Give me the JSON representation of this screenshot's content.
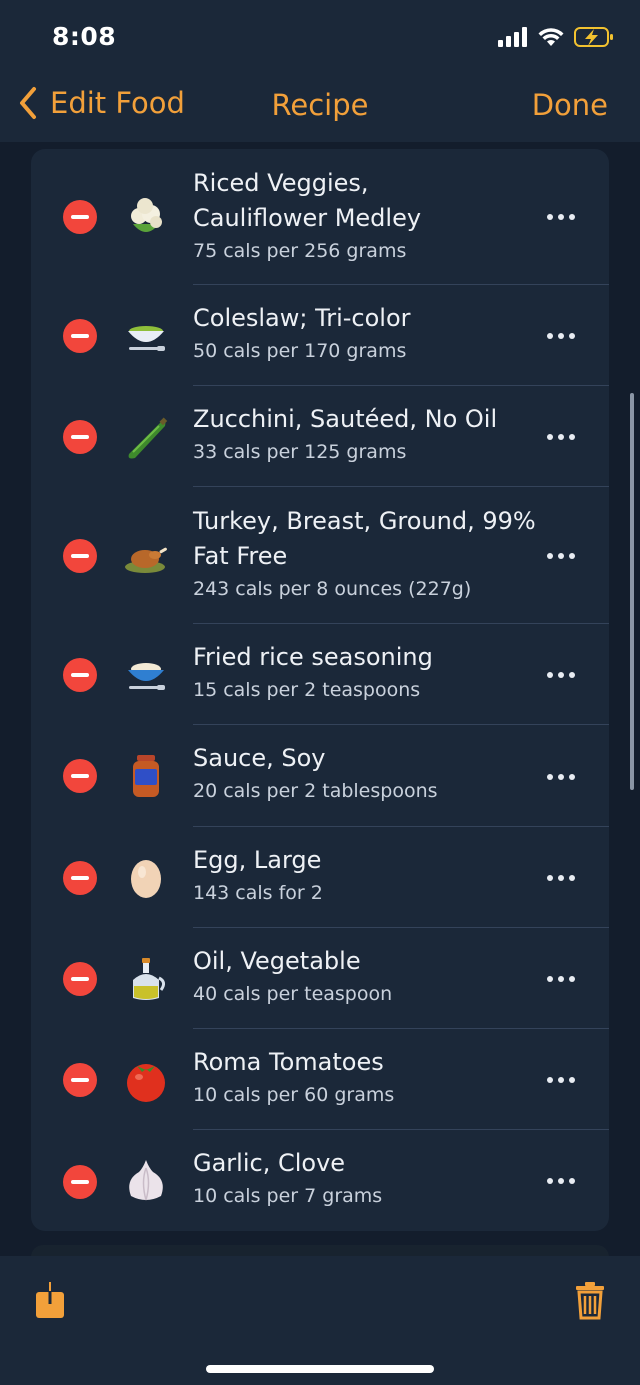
{
  "status_bar": {
    "time": "8:08"
  },
  "nav": {
    "back_label": "Edit Food",
    "title": "Recipe",
    "done_label": "Done"
  },
  "items": [
    {
      "name_lines": [
        "Riced Veggies,",
        "Cauliflower Medley"
      ],
      "cals": "75 cals per 256 grams",
      "icon": "cauliflower-icon"
    },
    {
      "name_lines": [
        "Coleslaw; Tri-color"
      ],
      "cals": "50 cals per 170 grams",
      "icon": "salad-bowl-icon"
    },
    {
      "name_lines": [
        "Zucchini, Sautéed, No Oil"
      ],
      "cals": "33 cals per 125 grams",
      "icon": "zucchini-icon"
    },
    {
      "name_lines": [
        "Turkey, Breast, Ground, 99%",
        "Fat Free"
      ],
      "cals": "243 cals per 8 ounces (227g)",
      "icon": "roast-poultry-icon"
    },
    {
      "name_lines": [
        "Fried rice seasoning"
      ],
      "cals": "15 cals per 2 teaspoons",
      "icon": "powder-bowl-icon"
    },
    {
      "name_lines": [
        "Sauce, Soy"
      ],
      "cals": "20 cals per 2 tablespoons",
      "icon": "sauce-jar-icon"
    },
    {
      "name_lines": [
        "Egg, Large"
      ],
      "cals": "143 cals for 2",
      "icon": "egg-icon"
    },
    {
      "name_lines": [
        "Oil, Vegetable"
      ],
      "cals": "40 cals per teaspoon",
      "icon": "oil-bottle-icon"
    },
    {
      "name_lines": [
        "Roma Tomatoes"
      ],
      "cals": "10 cals per 60 grams",
      "icon": "tomato-icon"
    },
    {
      "name_lines": [
        "Garlic, Clove"
      ],
      "cals": "10 cals per 7 grams",
      "icon": "garlic-icon"
    }
  ],
  "colors": {
    "accent": "#f2a03a",
    "delete": "#f2463c",
    "background": "#131d2c",
    "card": "#1b2839"
  },
  "toolbar": {
    "share_icon": "share-icon",
    "trash_icon": "trash-icon"
  }
}
